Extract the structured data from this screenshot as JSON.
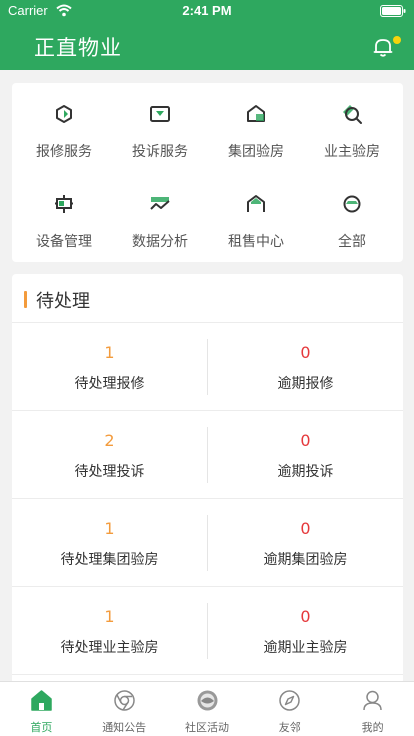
{
  "status_bar": {
    "carrier": "Carrier",
    "time": "2:41 PM"
  },
  "header": {
    "title": "正直物业",
    "notification_icon": "bell-icon",
    "dot_color": "#f6d40c"
  },
  "theme": {
    "accent": "#2ea85f",
    "orange": "#f39b3c",
    "red": "#e5383b"
  },
  "services": [
    {
      "label": "报修服务",
      "icon": "repair-icon"
    },
    {
      "label": "投诉服务",
      "icon": "complaint-icon"
    },
    {
      "label": "集团验房",
      "icon": "group-inspection-icon"
    },
    {
      "label": "业主验房",
      "icon": "owner-inspection-icon"
    },
    {
      "label": "设备管理",
      "icon": "equipment-icon"
    },
    {
      "label": "数据分析",
      "icon": "analytics-icon"
    },
    {
      "label": "租售中心",
      "icon": "rental-icon"
    },
    {
      "label": "全部",
      "icon": "all-icon"
    }
  ],
  "pending": {
    "title": "待处理",
    "rows": [
      {
        "left": {
          "count": "1",
          "label": "待处理报修"
        },
        "right": {
          "count": "0",
          "label": "逾期报修"
        }
      },
      {
        "left": {
          "count": "2",
          "label": "待处理投诉"
        },
        "right": {
          "count": "0",
          "label": "逾期投诉"
        }
      },
      {
        "left": {
          "count": "1",
          "label": "待处理集团验房"
        },
        "right": {
          "count": "0",
          "label": "逾期集团验房"
        }
      },
      {
        "left": {
          "count": "1",
          "label": "待处理业主验房"
        },
        "right": {
          "count": "0",
          "label": "逾期业主验房"
        }
      }
    ]
  },
  "tabs": [
    {
      "label": "首页",
      "icon": "home-icon",
      "active": true
    },
    {
      "label": "通知公告",
      "icon": "notice-icon",
      "active": false
    },
    {
      "label": "社区活动",
      "icon": "community-icon",
      "active": false
    },
    {
      "label": "友邻",
      "icon": "compass-icon",
      "active": false
    },
    {
      "label": "我的",
      "icon": "profile-icon",
      "active": false
    }
  ]
}
